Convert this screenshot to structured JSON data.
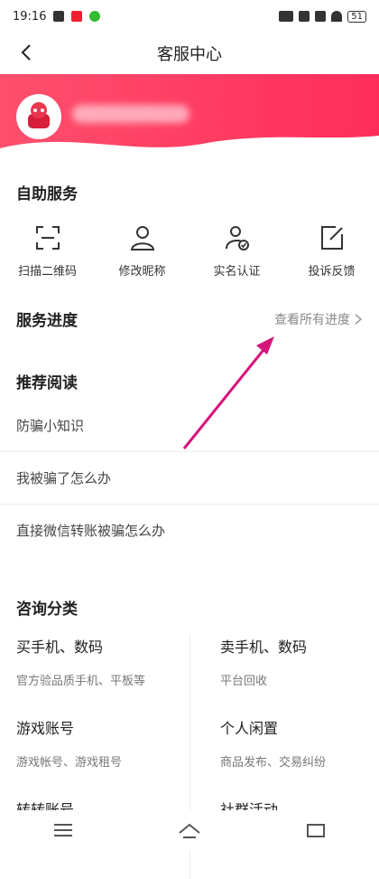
{
  "status": {
    "time": "19:16",
    "battery": "51"
  },
  "header": {
    "title": "客服中心"
  },
  "self_service": {
    "title": "自助服务",
    "items": [
      {
        "label": "扫描二维码",
        "icon": "scan-icon"
      },
      {
        "label": "修改昵称",
        "icon": "user-icon"
      },
      {
        "label": "实名认证",
        "icon": "verified-user-icon"
      },
      {
        "label": "投诉反馈",
        "icon": "edit-note-icon"
      }
    ]
  },
  "progress": {
    "title": "服务进度",
    "link": "查看所有进度"
  },
  "recommend": {
    "title": "推荐阅读",
    "items": [
      "防骗小知识",
      "我被骗了怎么办",
      "直接微信转账被骗怎么办"
    ]
  },
  "consult": {
    "title": "咨询分类",
    "cells": [
      {
        "title": "买手机、数码",
        "sub": "官方验品质手机、平板等"
      },
      {
        "title": "卖手机、数码",
        "sub": "平台回收"
      },
      {
        "title": "游戏账号",
        "sub": "游戏帐号、游戏租号"
      },
      {
        "title": "个人闲置",
        "sub": "商品发布、交易纠纷"
      },
      {
        "title": "转转账号",
        "sub": ""
      },
      {
        "title": "社群活动",
        "sub": ""
      }
    ]
  },
  "colors": {
    "banner": "#ff2d5a",
    "annotation_arrow": "#d6157a"
  }
}
